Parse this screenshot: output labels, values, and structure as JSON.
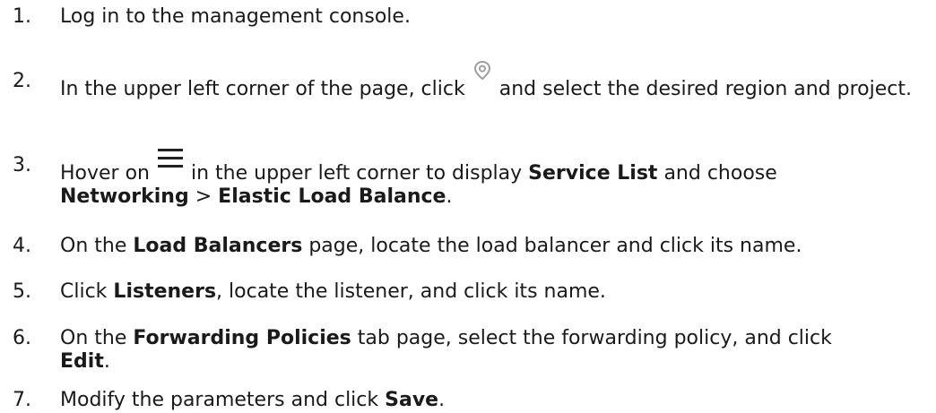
{
  "steps": [
    {
      "number": "1.",
      "parts": [
        "Log in to the management console."
      ]
    },
    {
      "number": "2.",
      "parts": [
        "In the upper left corner of the page, click",
        "and select the desired region and project."
      ]
    },
    {
      "number": "3.",
      "parts": [
        "Hover on",
        "in the upper left corner to display",
        "Service List",
        "and choose",
        "Networking",
        ">",
        "Elastic Load Balance",
        "."
      ]
    },
    {
      "number": "4.",
      "parts": [
        "On the",
        "Load Balancers",
        "page, locate the load balancer and click its name."
      ]
    },
    {
      "number": "5.",
      "parts": [
        "Click",
        "Listeners",
        ", locate the listener, and click its name."
      ]
    },
    {
      "number": "6.",
      "parts": [
        "On the",
        "Forwarding Policies",
        "tab page, select the forwarding policy, and click",
        "Edit",
        "."
      ]
    },
    {
      "number": "7.",
      "parts": [
        "Modify the parameters and click",
        "Save",
        "."
      ]
    }
  ],
  "icons": {
    "region_icon": "location-pin-icon",
    "menu_icon": "hamburger-menu-icon",
    "icon_color": "#9e9e9e",
    "menu_color": "#222222"
  }
}
